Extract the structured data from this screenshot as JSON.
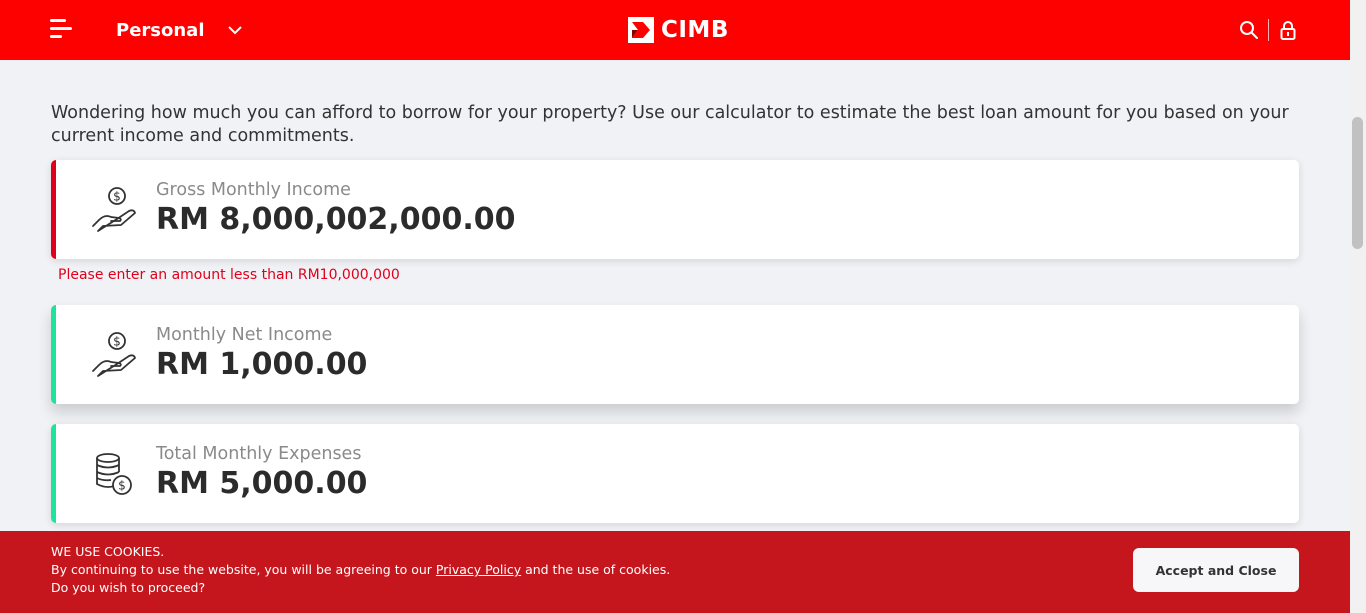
{
  "header": {
    "segment_label": "Personal",
    "brand_name": "CIMB",
    "icons": [
      "menu-icon",
      "chevron-down-icon",
      "search-icon",
      "lock-icon"
    ]
  },
  "intro": "Wondering how much you can afford to borrow for your property? Use our calculator to estimate the best loan amount for you based on your current income and commitments.",
  "fields": [
    {
      "label": "Gross Monthly Income",
      "value": "RM 8,000,002,000.00",
      "icon": "hand-money-icon",
      "accent": "#e0001b",
      "error": "Please enter an amount less than RM10,000,000"
    },
    {
      "label": "Monthly Net Income",
      "value": "RM 1,000.00",
      "icon": "hand-money-icon",
      "accent": "#1ee39b"
    },
    {
      "label": "Total Monthly Expenses",
      "value": "RM 5,000.00",
      "icon": "coins-stack-icon",
      "accent": "#1ee39b"
    }
  ],
  "cookie": {
    "title": "WE USE COOKIES.",
    "text_before": "By continuing to use the website, you will be agreeing to our ",
    "link": "Privacy Policy",
    "text_after": " and the use of cookies.",
    "question": "Do you wish to proceed?",
    "button": "Accept and Close"
  },
  "colors": {
    "header": "#fd0000",
    "banner": "#c4161c",
    "error": "#e0001b",
    "accent_valid": "#1ee39b"
  }
}
